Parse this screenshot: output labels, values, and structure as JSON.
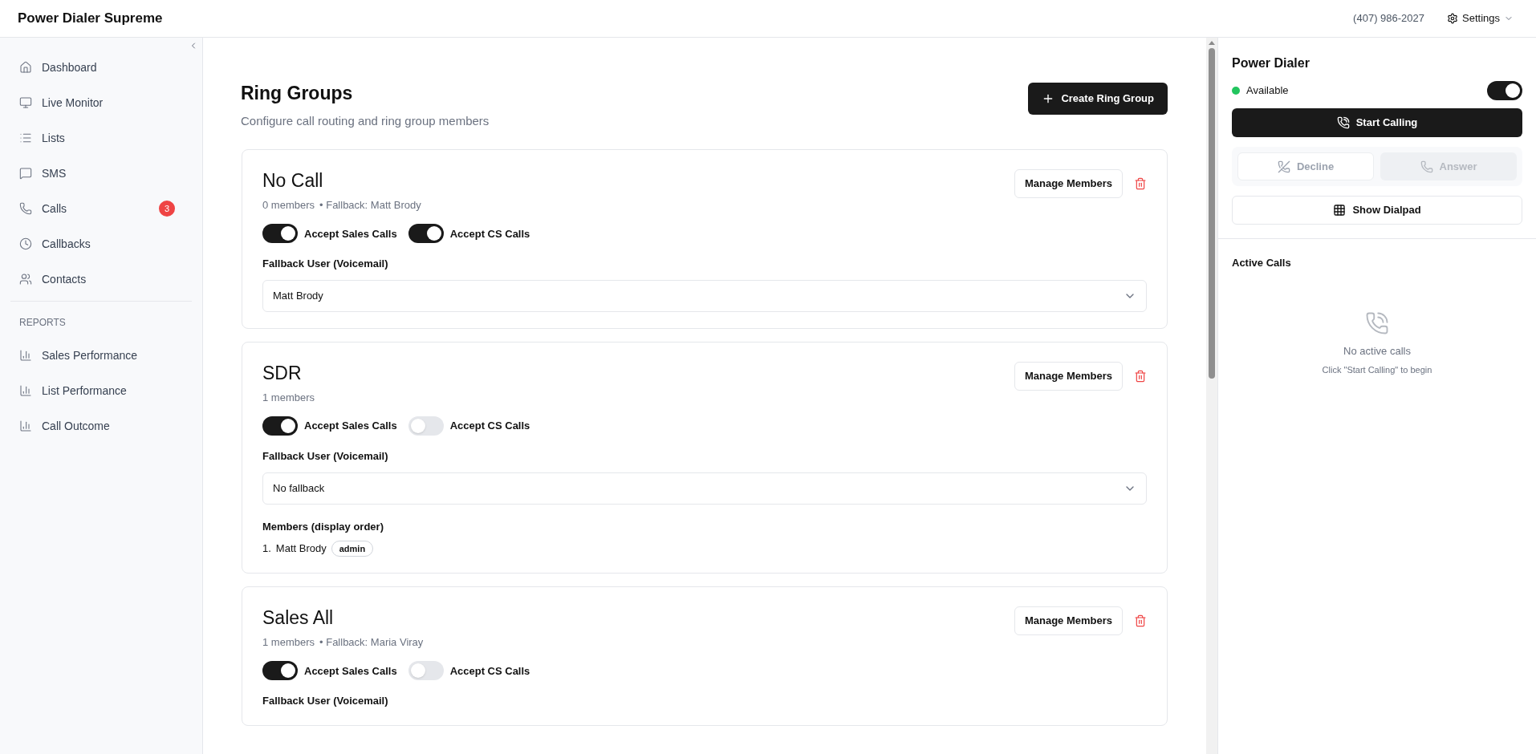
{
  "header": {
    "app_title": "Power Dialer Supreme",
    "phone": "(407) 986-2027",
    "settings_label": "Settings"
  },
  "sidebar": {
    "items": [
      {
        "kind": "home",
        "label": "Dashboard"
      },
      {
        "kind": "monitor",
        "label": "Live Monitor"
      },
      {
        "kind": "list",
        "label": "Lists"
      },
      {
        "kind": "message",
        "label": "SMS"
      },
      {
        "kind": "phone",
        "label": "Calls",
        "badge": "3"
      },
      {
        "kind": "clock",
        "label": "Callbacks"
      },
      {
        "kind": "users",
        "label": "Contacts"
      }
    ],
    "section_title": "REPORTS",
    "report_items": [
      {
        "label": "Sales Performance"
      },
      {
        "label": "List Performance"
      },
      {
        "label": "Call Outcome"
      }
    ]
  },
  "main": {
    "title": "Ring Groups",
    "subtitle": "Configure call routing and ring group members",
    "create_button": "Create Ring Group",
    "groups": [
      {
        "name": "No Call",
        "members_count": "0 members",
        "fallback_note": "• Fallback: Matt Brody",
        "manage_button": "Manage Members",
        "toggles": [
          {
            "label": "Accept Sales Calls",
            "on": true
          },
          {
            "label": "Accept CS Calls",
            "on": true
          }
        ],
        "fallback_label": "Fallback User (Voicemail)",
        "fallback_value": "Matt Brody"
      },
      {
        "name": "SDR",
        "members_count": "1 members",
        "manage_button": "Manage Members",
        "toggles": [
          {
            "label": "Accept Sales Calls",
            "on": true
          },
          {
            "label": "Accept CS Calls",
            "on": false
          }
        ],
        "fallback_label": "Fallback User (Voicemail)",
        "fallback_value": "No fallback",
        "members_title": "Members (display order)",
        "members": [
          {
            "index": "1.",
            "name": "Matt Brody",
            "role": "admin"
          }
        ]
      },
      {
        "name": "Sales All",
        "members_count": "1 members",
        "fallback_note": "• Fallback: Maria Viray",
        "manage_button": "Manage Members",
        "toggles": [
          {
            "label": "Accept Sales Calls",
            "on": true
          },
          {
            "label": "Accept CS Calls",
            "on": false
          }
        ],
        "fallback_label": "Fallback User (Voicemail)"
      }
    ]
  },
  "dialer": {
    "title": "Power Dialer",
    "status": {
      "label": "Available",
      "color": "#22c55e",
      "on": true
    },
    "start_button": "Start Calling",
    "decline": {
      "label": "Decline",
      "disabled": true
    },
    "answer": {
      "label": "Answer",
      "disabled": true
    },
    "dialpad_button": "Show Dialpad",
    "active_calls_title": "Active Calls",
    "empty_title": "No active calls",
    "empty_hint": "Click \"Start Calling\" to begin"
  }
}
